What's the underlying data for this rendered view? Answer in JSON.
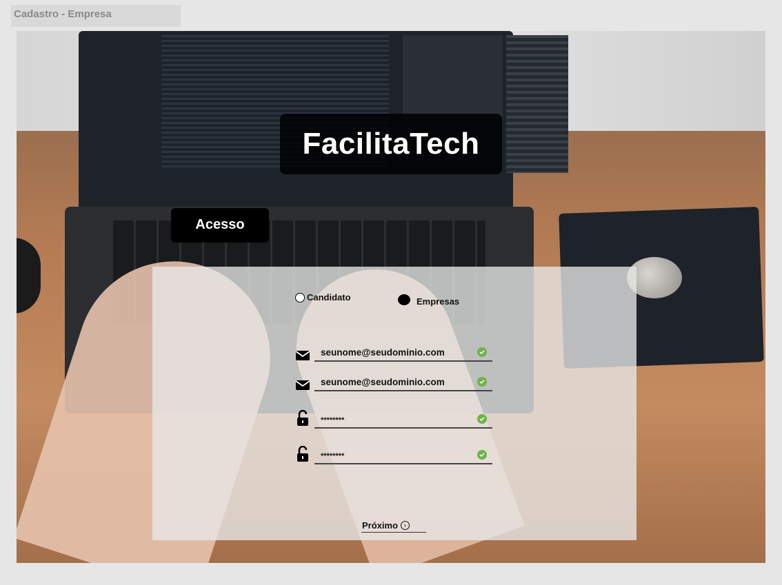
{
  "page": {
    "label": "Cadastro - Empresa"
  },
  "brand": {
    "name": "FacilitaTech"
  },
  "tab": {
    "label": "Acesso"
  },
  "account_type": {
    "options": [
      {
        "label": "Candidato",
        "selected": false
      },
      {
        "label": "Empresas",
        "selected": true
      }
    ]
  },
  "form": {
    "email": {
      "value": "seunome@seudominio.com",
      "icon": "envelope-icon",
      "valid": true
    },
    "email_confirm": {
      "value": "seunome@seudominio.com",
      "icon": "envelope-icon",
      "valid": true
    },
    "password": {
      "value": "********",
      "icon": "unlock-icon",
      "valid": true
    },
    "password_confirm": {
      "value": "********",
      "icon": "unlock-icon",
      "valid": true
    },
    "next_label": "Próximo",
    "next_icon": "arrow-right-circle-icon"
  },
  "colors": {
    "valid_check": "#6fb34a",
    "brand_bg": "#000000",
    "panel_bg": "#e8e8e8"
  }
}
